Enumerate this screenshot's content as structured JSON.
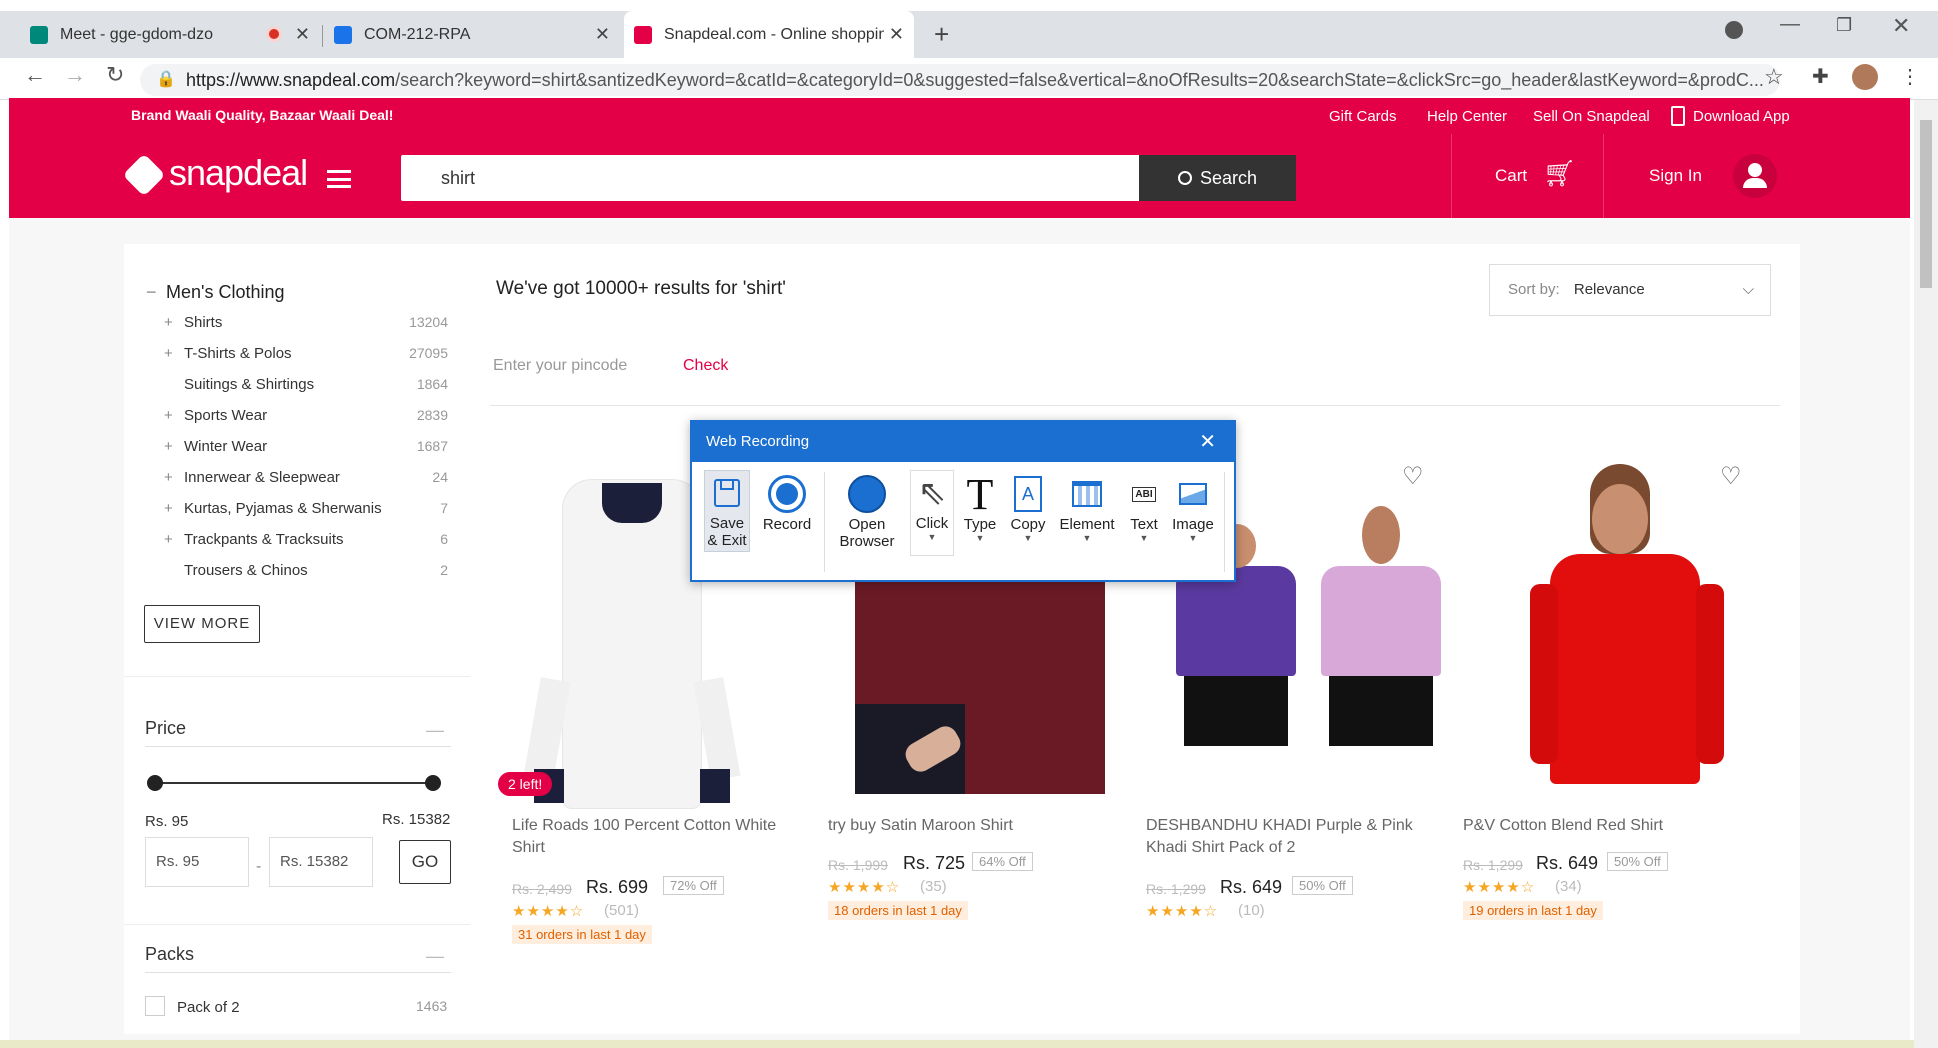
{
  "browser": {
    "tabs": [
      {
        "title": "Meet - gge-gdom-dzo"
      },
      {
        "title": "COM-212-RPA"
      },
      {
        "title": "Snapdeal.com - Online shopping"
      }
    ],
    "url_host": "https://www.snapdeal.com",
    "url_path": "/search?keyword=shirt&santizedKeyword=&catId=&categoryId=0&suggested=false&vertical=&noOfResults=20&searchState=&clickSrc=go_header&lastKeyword=&prodC..."
  },
  "topbar": {
    "tagline": "Brand Waali Quality, Bazaar Waali Deal!",
    "links": [
      "Gift Cards",
      "Help Center",
      "Sell On Snapdeal",
      "Download App"
    ]
  },
  "header": {
    "logo": "snapdeal",
    "search_value": "shirt",
    "search_button": "Search",
    "cart": "Cart",
    "signin": "Sign In"
  },
  "sidebar": {
    "category_title": "Men's Clothing",
    "categories": [
      {
        "label": "Shirts",
        "count": "13204",
        "plus": "+"
      },
      {
        "label": "T-Shirts & Polos",
        "count": "27095",
        "plus": "+"
      },
      {
        "label": "Suitings & Shirtings",
        "count": "1864",
        "plus": ""
      },
      {
        "label": "Sports Wear",
        "count": "2839",
        "plus": "+"
      },
      {
        "label": "Winter Wear",
        "count": "1687",
        "plus": "+"
      },
      {
        "label": "Innerwear & Sleepwear",
        "count": "24",
        "plus": "+"
      },
      {
        "label": "Kurtas, Pyjamas & Sherwanis",
        "count": "7",
        "plus": "+"
      },
      {
        "label": "Trackpants & Tracksuits",
        "count": "6",
        "plus": "+"
      },
      {
        "label": "Trousers & Chinos",
        "count": "2",
        "plus": ""
      }
    ],
    "view_more": "VIEW MORE",
    "price_title": "Price",
    "price_min_label": "Rs. 95",
    "price_max_label": "Rs. 15382",
    "price_min_input": "Rs. 95",
    "price_max_input": "Rs. 15382",
    "go": "GO",
    "packs_title": "Packs",
    "pack_option": "Pack of 2",
    "pack_count": "1463"
  },
  "results": {
    "heading": "We've got 10000+ results for 'shirt'",
    "sort_label": "Sort by:",
    "sort_value": "Relevance",
    "pincode_placeholder": "Enter your pincode",
    "check": "Check"
  },
  "products": [
    {
      "title_l1": "Life Roads 100 Percent Cotton White",
      "title_l2": "Shirt",
      "old": "Rs. 2,499",
      "price": "Rs. 699",
      "off": "72% Off",
      "stars": "★★★★☆",
      "reviews": "(501)",
      "orders": "31 orders in last 1 day",
      "badge": "2 left!"
    },
    {
      "title_l1": "try buy Satin Maroon Shirt",
      "title_l2": "",
      "old": "Rs. 1,999",
      "price": "Rs. 725",
      "off": "64% Off",
      "stars": "★★★★☆",
      "reviews": "(35)",
      "orders": "18 orders in last 1 day",
      "badge": ""
    },
    {
      "title_l1": "DESHBANDHU KHADI Purple & Pink",
      "title_l2": "Khadi Shirt Pack of 2",
      "old": "Rs. 1,299",
      "price": "Rs. 649",
      "off": "50% Off",
      "stars": "★★★★☆",
      "reviews": "(10)",
      "orders": "",
      "badge": ""
    },
    {
      "title_l1": "P&V Cotton Blend Red Shirt",
      "title_l2": "",
      "old": "Rs. 1,299",
      "price": "Rs. 649",
      "off": "50% Off",
      "stars": "★★★★☆",
      "reviews": "(34)",
      "orders": "19 orders in last 1 day",
      "badge": ""
    }
  ],
  "recorder": {
    "title": "Web Recording",
    "tools": [
      {
        "label": "Save",
        "label2": "& Exit",
        "icon": "save-icon"
      },
      {
        "label": "Record",
        "label2": "",
        "icon": "record-icon"
      },
      {
        "label": "Open",
        "label2": "Browser",
        "icon": "globe-icon"
      },
      {
        "label": "Click",
        "label2": "",
        "icon": "cursor-icon"
      },
      {
        "label": "Type",
        "label2": "",
        "icon": "type-icon"
      },
      {
        "label": "Copy",
        "label2": "",
        "icon": "copy-icon"
      },
      {
        "label": "Element",
        "label2": "",
        "icon": "element-icon"
      },
      {
        "label": "Text",
        "label2": "",
        "icon": "text-icon"
      },
      {
        "label": "Image",
        "label2": "",
        "icon": "image-icon"
      }
    ]
  },
  "colors": {
    "brand": "#e40046",
    "recorder": "#1a6fd0"
  }
}
